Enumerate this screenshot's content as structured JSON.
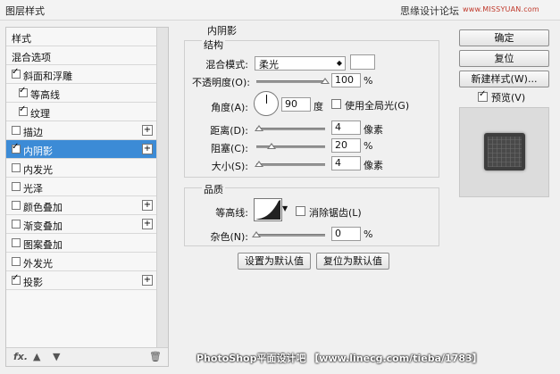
{
  "window": {
    "title": "图层样式"
  },
  "watermark": {
    "site_text": "思缘设计论坛",
    "site_url": "www.MISSYUAN.com",
    "bottom": "PhotoShop平面设计吧 【www.linecg.com/tieba/1783】"
  },
  "sidebar": {
    "items": [
      {
        "label": "样式",
        "check": null,
        "plus": false,
        "selected": false
      },
      {
        "label": "混合选项",
        "check": null,
        "plus": false,
        "selected": false
      },
      {
        "label": "斜面和浮雕",
        "check": true,
        "plus": false,
        "selected": false
      },
      {
        "label": "等高线",
        "check": true,
        "plus": false,
        "selected": false
      },
      {
        "label": "纹理",
        "check": true,
        "plus": false,
        "selected": false
      },
      {
        "label": "描边",
        "check": false,
        "plus": true,
        "selected": false
      },
      {
        "label": "内阴影",
        "check": true,
        "plus": true,
        "selected": true
      },
      {
        "label": "内发光",
        "check": false,
        "plus": false,
        "selected": false
      },
      {
        "label": "光泽",
        "check": false,
        "plus": false,
        "selected": false
      },
      {
        "label": "颜色叠加",
        "check": false,
        "plus": true,
        "selected": false
      },
      {
        "label": "渐变叠加",
        "check": false,
        "plus": true,
        "selected": false
      },
      {
        "label": "图案叠加",
        "check": false,
        "plus": false,
        "selected": false
      },
      {
        "label": "外发光",
        "check": false,
        "plus": false,
        "selected": false
      },
      {
        "label": "投影",
        "check": true,
        "plus": true,
        "selected": false
      }
    ],
    "bottom_fx": "fx.",
    "bottom_up": "▲",
    "bottom_down": "▼",
    "bottom_trash": "🗑"
  },
  "panel": {
    "title": "内阴影",
    "structure": {
      "title": "结构",
      "blend_mode_label": "混合模式:",
      "blend_mode_value": "柔光",
      "opacity_label": "不透明度(O):",
      "opacity_value": "100",
      "opacity_unit": "%",
      "opacity_level": 1.0,
      "angle_label": "角度(A):",
      "angle_value": "90",
      "angle_unit": "度",
      "global_light_label": "使用全局光(G)",
      "global_light_checked": false,
      "distance_label": "距离(D):",
      "distance_value": "4",
      "distance_unit": "像素",
      "choke_label": "阻塞(C):",
      "choke_value": "20",
      "choke_unit": "%",
      "size_label": "大小(S):",
      "size_value": "4",
      "size_unit": "像素"
    },
    "quality": {
      "title": "品质",
      "contour_label": "等高线:",
      "antialias_label": "消除锯齿(L)",
      "antialias_checked": false,
      "noise_label": "杂色(N):",
      "noise_value": "0",
      "noise_unit": "%"
    },
    "set_default": "设置为默认值",
    "reset_default": "复位为默认值"
  },
  "actions": {
    "ok": "确定",
    "reset": "复位",
    "new_style": "新建样式(W)...",
    "preview_label": "预览(V)",
    "preview_checked": true
  }
}
